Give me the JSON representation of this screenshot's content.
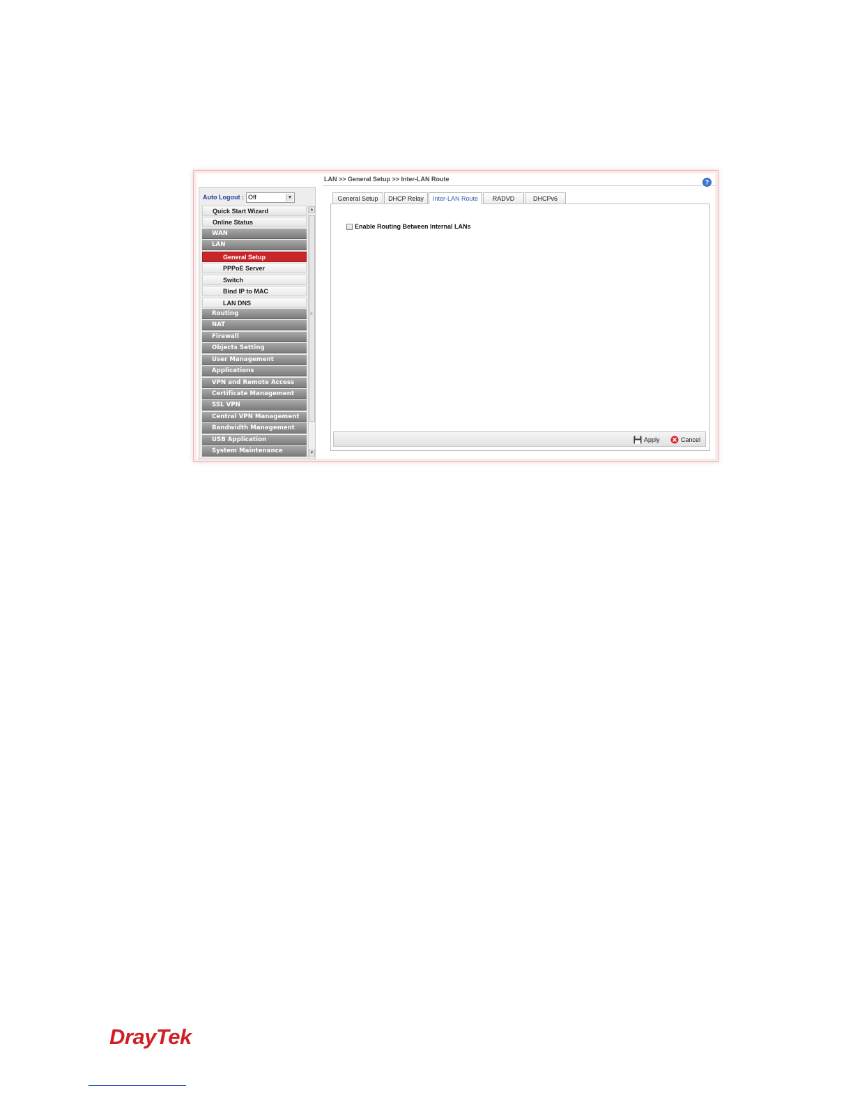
{
  "breadcrumb": "LAN >> General Setup >> Inter-LAN Route",
  "auto_logout": {
    "label": "Auto Logout :",
    "value": "Off"
  },
  "menu": [
    {
      "label": "Quick Start Wizard",
      "style": "light"
    },
    {
      "label": "Online Status",
      "style": "light"
    },
    {
      "label": "WAN",
      "style": "dark"
    },
    {
      "label": "LAN",
      "style": "dark"
    },
    {
      "label": "General Setup",
      "style": "active"
    },
    {
      "label": "PPPoE Server",
      "style": "sub"
    },
    {
      "label": "Switch",
      "style": "sub"
    },
    {
      "label": "Bind IP to MAC",
      "style": "sub"
    },
    {
      "label": "LAN DNS",
      "style": "sub"
    },
    {
      "label": "Routing",
      "style": "dark"
    },
    {
      "label": "NAT",
      "style": "dark"
    },
    {
      "label": "Firewall",
      "style": "dark"
    },
    {
      "label": "Objects Setting",
      "style": "dark"
    },
    {
      "label": "User Management",
      "style": "dark"
    },
    {
      "label": "Applications",
      "style": "dark"
    },
    {
      "label": "VPN and Remote Access",
      "style": "dark"
    },
    {
      "label": "Certificate Management",
      "style": "dark"
    },
    {
      "label": "SSL VPN",
      "style": "dark"
    },
    {
      "label": "Central VPN Management",
      "style": "dark"
    },
    {
      "label": "Bandwidth Management",
      "style": "dark"
    },
    {
      "label": "USB Application",
      "style": "dark"
    },
    {
      "label": "System Maintenance",
      "style": "dark"
    }
  ],
  "tabs": [
    {
      "label": "General Setup",
      "active": false
    },
    {
      "label": "DHCP Relay",
      "active": false
    },
    {
      "label": "Inter-LAN Route",
      "active": true
    },
    {
      "label": "RADVD",
      "active": false
    },
    {
      "label": "DHCPv6",
      "active": false
    }
  ],
  "option": {
    "label": "Enable Routing Between Internal LANs",
    "checked": false
  },
  "buttons": {
    "apply": "Apply",
    "cancel": "Cancel"
  },
  "logo": "DrayTek",
  "colors": {
    "active_menu": "#c8262a",
    "logo": "#d01f24",
    "tab_active_text": "#2e5fb0"
  }
}
